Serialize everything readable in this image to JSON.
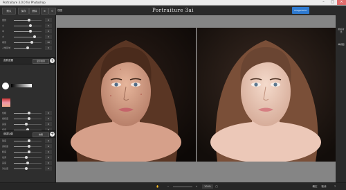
{
  "window": {
    "title": "Portraiture 3.0.0 for Photoshop"
  },
  "topbar": {
    "preset_value": "默认",
    "btn_save": "保存",
    "btn_delete": "删除",
    "left_label": "视图",
    "app_title": "Portraiture 3ai",
    "badge": "Imagenomic"
  },
  "panel": {
    "sliders1": [
      {
        "label": "细微",
        "value": "0"
      },
      {
        "label": "小",
        "value": "0"
      },
      {
        "label": "中",
        "value": "0"
      },
      {
        "label": "大",
        "value": "0"
      },
      {
        "label": "阈值",
        "value": "10"
      },
      {
        "label": "人像区域",
        "value": "0"
      }
    ],
    "mask_section": {
      "title": "皮肤遮罩",
      "button": "显示遮罩"
    },
    "sliders2": [
      {
        "label": "色相",
        "value": "0"
      },
      {
        "label": "饱和度",
        "value": "0"
      },
      {
        "label": "亮度",
        "value": "0"
      },
      {
        "label": "纬度",
        "value": "0"
      }
    ],
    "enhance_section": {
      "title": "增强功能",
      "button": "效果"
    },
    "sliders3": [
      {
        "label": "锐度",
        "value": "0"
      },
      {
        "label": "柔和度",
        "value": "0"
      },
      {
        "label": "暖度",
        "value": "0"
      },
      {
        "label": "色调",
        "value": "0"
      },
      {
        "label": "亮度",
        "value": "0"
      },
      {
        "label": "对比度",
        "value": "0"
      }
    ]
  },
  "rtool": {
    "before_after": "前后对比",
    "one_pane": "单视图"
  },
  "bottombar": {
    "zoom": "100%",
    "ok": "确定",
    "cancel": "取消"
  },
  "colors": {
    "accent": "#2e7ad1",
    "panel_bg": "#2e2e2e",
    "viewer_bg": "#858585"
  }
}
